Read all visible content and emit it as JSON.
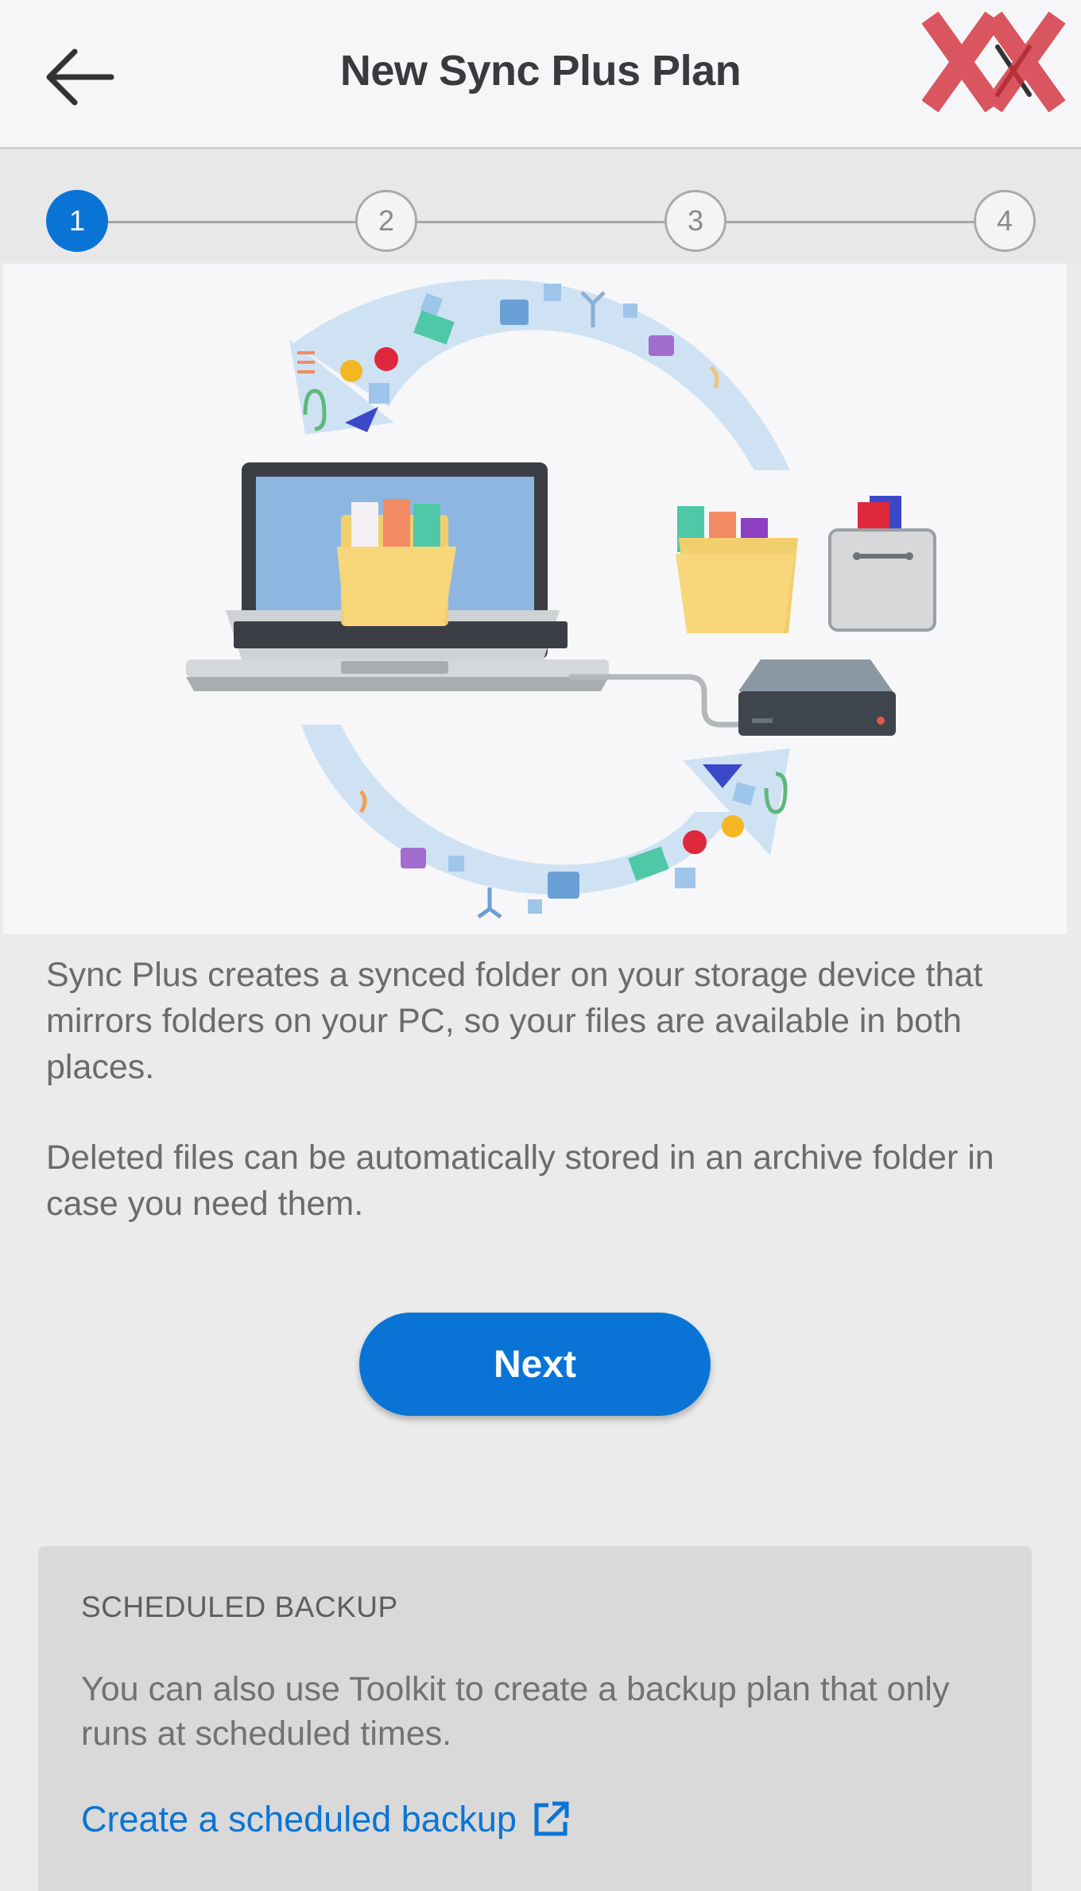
{
  "header": {
    "title": "New Sync Plus Plan",
    "back_icon": "arrow-left-icon",
    "close_icon": "close-icon"
  },
  "stepper": {
    "steps": [
      "1",
      "2",
      "3",
      "4"
    ],
    "current": "1"
  },
  "main": {
    "paragraph1": "Sync Plus creates a synced folder on your storage device that mirrors folders on your PC, so your files are available in both places.",
    "paragraph2": "Deleted files can be automatically stored in an archive folder in case you need them.",
    "next_label": "Next"
  },
  "scheduled_backup": {
    "title": "SCHEDULED BACKUP",
    "text": "You can also use Toolkit to create a backup plan that only runs at scheduled times.",
    "link_label": "Create a scheduled backup",
    "link_icon": "external-link-icon"
  },
  "colors": {
    "accent": "#0a74d6",
    "watermark": "#d32f3c"
  }
}
